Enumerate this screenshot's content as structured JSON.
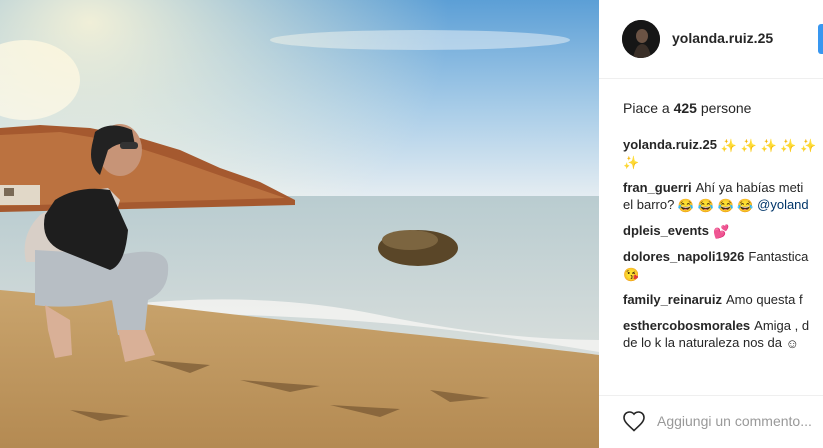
{
  "post": {
    "username": "yolanda.ruiz.25",
    "likes_prefix": "Piace a ",
    "likes_count": "425",
    "likes_suffix": " persone",
    "add_comment_placeholder": "Aggiungi un commento..."
  },
  "comments": [
    {
      "user": "yolanda.ruiz.25",
      "line1_emoji": "✨ ✨ ✨ ✨ ✨",
      "line2_emoji": "✨"
    },
    {
      "user": "fran_guerri",
      "text": "Ahí ya habías meti",
      "cont_text": "el barro? ",
      "cont_emoji": "😂 😂 😂 😂",
      "mention": "@yoland"
    },
    {
      "user": "dpleis_events",
      "emoji": "💕"
    },
    {
      "user": "dolores_napoli1926",
      "text": "Fantastica",
      "cont_emoji": "😘"
    },
    {
      "user": "family_reinaruiz",
      "text": "Amo questa f"
    },
    {
      "user": "esthercobosmorales",
      "text": "Amiga , d",
      "cont_text": "de lo k la naturaleza nos da ",
      "cont_emoji": "☺"
    }
  ],
  "icons": {
    "avatar": "profile-avatar",
    "like": "heart-outline-icon"
  },
  "colors": {
    "username": "#262626",
    "mention": "#003569",
    "placeholder": "#999999",
    "divider": "#efefef"
  }
}
